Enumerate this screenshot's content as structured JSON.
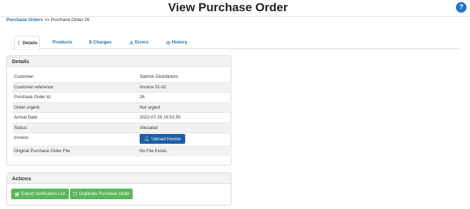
{
  "header": {
    "title": "View Purchase Order",
    "help_icon": "question-circle-icon"
  },
  "breadcrumb": {
    "link": "Purchase Orders",
    "separator": ">>",
    "current": "Purchase Order 26"
  },
  "tabs": [
    {
      "label": "Details",
      "icon": "list-icon",
      "glyph": "⋮",
      "active": true
    },
    {
      "label": "Products",
      "icon": "",
      "glyph": "",
      "active": false
    },
    {
      "label": "Charges",
      "icon": "dollar-icon",
      "glyph": "$",
      "active": false
    },
    {
      "label": "Errors",
      "icon": "warning-icon",
      "glyph": "⚠",
      "active": false
    },
    {
      "label": "History",
      "icon": "clock-icon",
      "glyph": "◷",
      "active": false
    }
  ],
  "details": {
    "title": "Details",
    "rows": [
      {
        "label": "Customer:",
        "value": "Salmon Distributors"
      },
      {
        "label": "Customer reference:",
        "value": "Invoice 02-32"
      },
      {
        "label": "Purchase Order Id:",
        "value": "26"
      },
      {
        "label": "Order urgent:",
        "value": "Not urgent"
      },
      {
        "label": "Arrival Date:",
        "value": "2022-07-25 16:52:55"
      },
      {
        "label": "Status:",
        "value": "Allocated"
      },
      {
        "label": "Invoice:",
        "value": ""
      },
      {
        "label": "Original Purchase Order File",
        "value": "No File Exists."
      }
    ],
    "upload_label": "Upload Invoice",
    "upload_icon": "user-upload-icon"
  },
  "actions": {
    "title": "Actions",
    "export_label": "Export Verification List",
    "export_icon": "table-icon",
    "duplicate_label": "Duplicate Purchase Order",
    "duplicate_icon": "copy-icon"
  },
  "colors": {
    "link": "#1a6cb5",
    "primary_button": "#1d5fa6",
    "success_button": "#5cb85c",
    "help": "#1a73c8"
  }
}
